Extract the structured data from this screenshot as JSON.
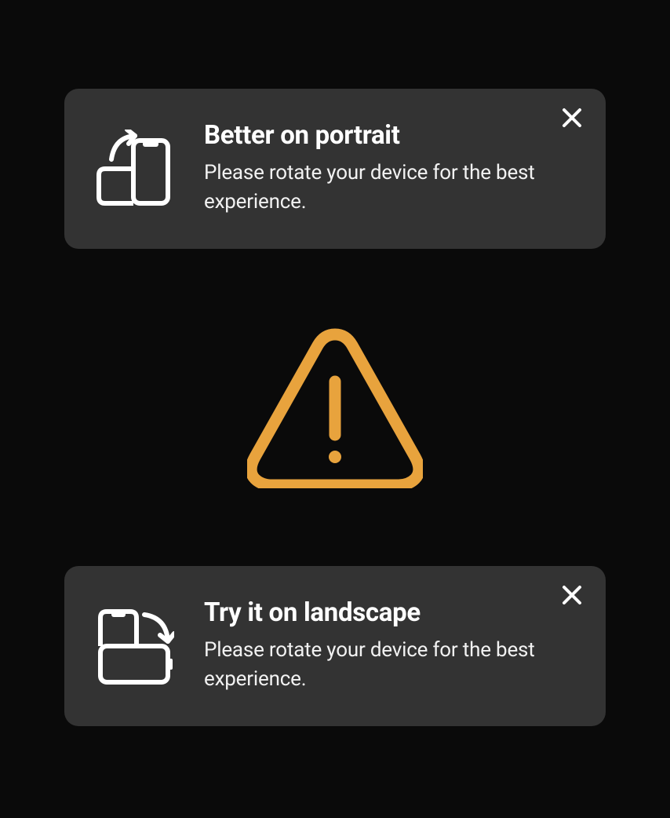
{
  "toasts": [
    {
      "title": "Better on portrait",
      "description": "Please rotate your device for the best experience.",
      "icon": "rotate-to-portrait-icon"
    },
    {
      "title": "Try it on landscape",
      "description": "Please rotate your device for the best experience.",
      "icon": "rotate-to-landscape-icon"
    }
  ],
  "center_icon": "warning-triangle-icon",
  "colors": {
    "background": "#0a0a0a",
    "toast_bg": "#333333",
    "text": "#ffffff",
    "warning": "#e8a33d"
  }
}
